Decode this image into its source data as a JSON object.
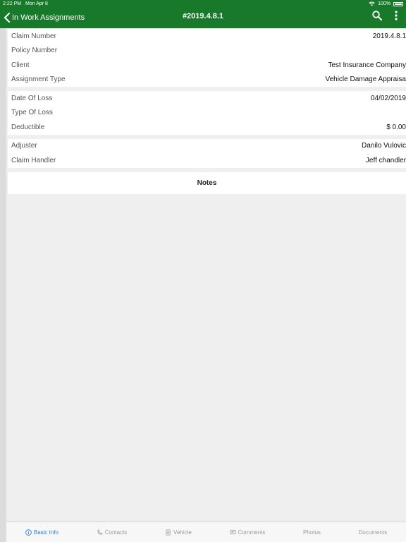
{
  "status_bar": {
    "time": "2:22 PM",
    "date": "Mon Apr 8",
    "battery": "100%"
  },
  "nav": {
    "back_label": "In Work Assignments",
    "title": "#2019.4.8.1"
  },
  "groups": [
    {
      "rows": [
        {
          "label": "Claim Number",
          "value": "2019.4.8.1"
        },
        {
          "label": "Policy Number",
          "value": ""
        },
        {
          "label": "Client",
          "value": "Test Insurance Company"
        },
        {
          "label": "Assignment Type",
          "value": "Vehicle Damage Appraisa"
        }
      ]
    },
    {
      "rows": [
        {
          "label": "Date Of Loss",
          "value": "04/02/2019"
        },
        {
          "label": "Type Of Loss",
          "value": ""
        },
        {
          "label": "Deductible",
          "value": "$ 0.00"
        }
      ]
    },
    {
      "rows": [
        {
          "label": "Adjuster",
          "value": "Danilo Vulovic"
        },
        {
          "label": "Claim Handler",
          "value": "Jeff chandler"
        }
      ]
    }
  ],
  "notes": {
    "label": "Notes"
  },
  "tabs": [
    {
      "label": "Basic Info",
      "icon": "info-icon"
    },
    {
      "label": "Contacts",
      "icon": "contacts-icon"
    },
    {
      "label": "Vehicle",
      "icon": "vehicle-icon"
    },
    {
      "label": "Comments",
      "icon": "comments-icon"
    },
    {
      "label": "Photos",
      "icon": ""
    },
    {
      "label": "Documents",
      "icon": ""
    }
  ],
  "colors": {
    "primary": "#18792b",
    "active_tab": "#2a7fd4"
  }
}
